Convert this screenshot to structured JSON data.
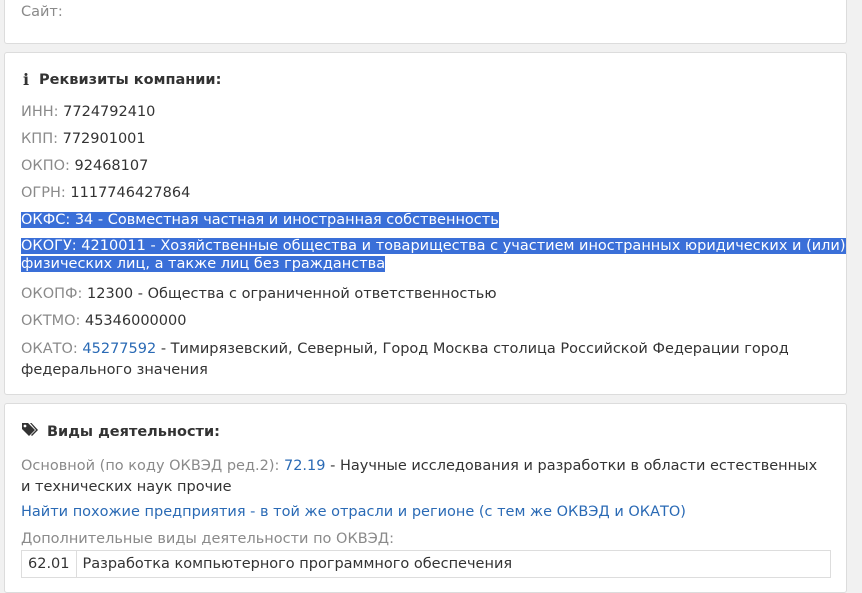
{
  "site": {
    "label": "Сайт:"
  },
  "requisites": {
    "title": "Реквизиты компании:",
    "inn": {
      "label": "ИНН:",
      "value": "7724792410"
    },
    "kpp": {
      "label": "КПП:",
      "value": "772901001"
    },
    "okpo": {
      "label": "ОКПО:",
      "value": "92468107"
    },
    "ogrn": {
      "label": "ОГРН:",
      "value": "1117746427864"
    },
    "okfs": {
      "label": "ОКФС:",
      "value": "34 - Совместная частная и иностранная собственность"
    },
    "okogu": {
      "label": "ОКОГУ:",
      "value_line1": "4210011 - Хозяйственные общества и товарищества с участием иностранных юридических и (или)",
      "value_line2": "физических лиц, а также лиц без гражданства"
    },
    "okopf": {
      "label": "ОКОПФ:",
      "value": "12300 - Общества с ограниченной ответственностью"
    },
    "oktmo": {
      "label": "ОКТМО:",
      "value": "45346000000"
    },
    "okato": {
      "label": "ОКАТО:",
      "link": "45277592",
      "desc": " - Тимирязевский, Северный, Город Москва столица Российской Федерации город федерального значения"
    }
  },
  "activities": {
    "title": "Виды деятельности:",
    "main_label": "Основной (по коду ОКВЭД ред.2):",
    "main_code": "72.19",
    "main_desc": " - Научные исследования и разработки в области естественных и технических наук прочие",
    "similar_link": "Найти похожие предприятия - в той же отрасли и регионе (с тем же ОКВЭД и ОКАТО)",
    "extra_label": "Дополнительные виды деятельности по ОКВЭД:",
    "extra": [
      {
        "code": "62.01",
        "desc": "Разработка компьютерного программного обеспечения"
      }
    ]
  }
}
